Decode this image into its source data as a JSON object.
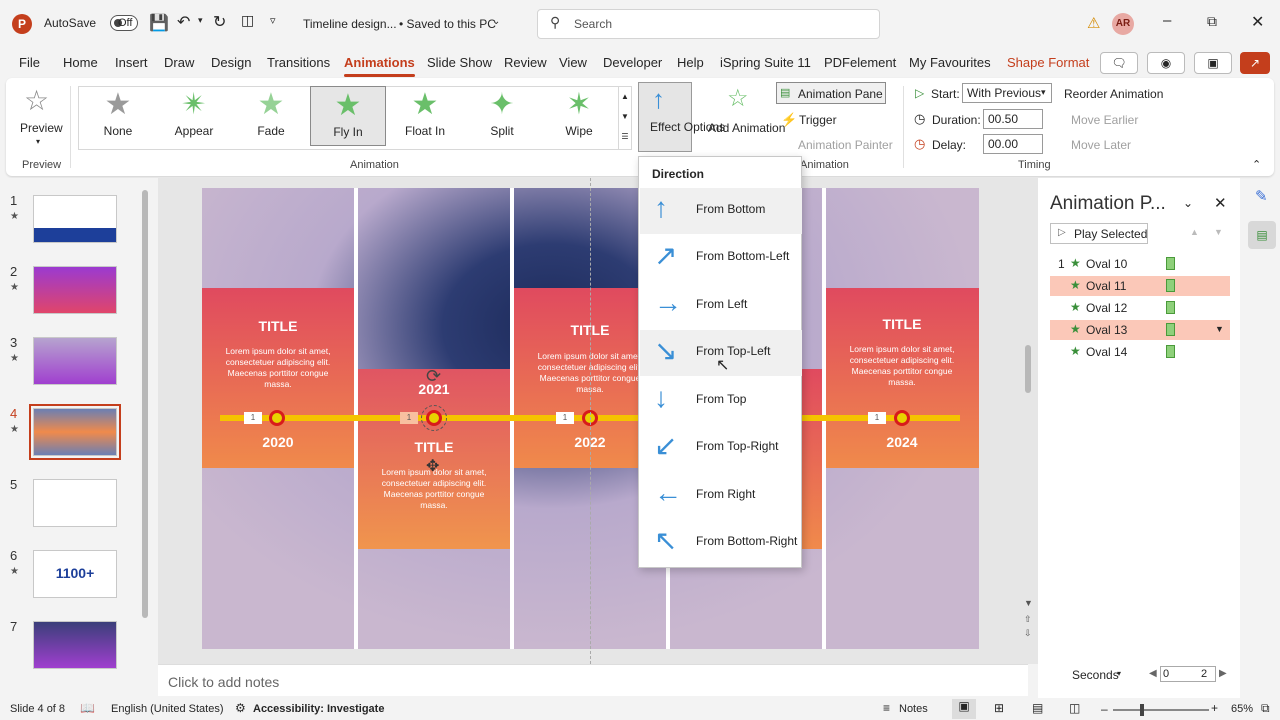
{
  "titlebar": {
    "logo": "P",
    "autosave_label": "AutoSave",
    "autosave_state": "Off",
    "doc_title": "Timeline design...",
    "save_status": "• Saved to this PC",
    "search_placeholder": "Search",
    "avatar_initials": "AR"
  },
  "menu": {
    "items": [
      "File",
      "Home",
      "Insert",
      "Draw",
      "Design",
      "Transitions",
      "Animations",
      "Slide Show",
      "Review",
      "View",
      "Developer",
      "Help",
      "iSpring Suite 11",
      "PDFelement",
      "My Favourites",
      "Shape Format"
    ],
    "active": "Animations"
  },
  "ribbon": {
    "preview_label": "Preview",
    "preview_group": "Preview",
    "animation_group": "Animation",
    "gallery": [
      "None",
      "Appear",
      "Fade",
      "Fly In",
      "Float In",
      "Split",
      "Wipe"
    ],
    "gallery_selected": "Fly In",
    "effect_options": "Effect Options",
    "add_animation": "Add Animation",
    "animation_pane_btn": "Animation Pane",
    "trigger": "Trigger",
    "animation_painter": "Animation Painter",
    "adv_group": "Animation",
    "start_label": "Start:",
    "start_value": "With Previous",
    "duration_label": "Duration:",
    "duration_value": "00.50",
    "delay_label": "Delay:",
    "delay_value": "00.00",
    "reorder": "Reorder Animation",
    "move_earlier": "Move Earlier",
    "move_later": "Move Later",
    "timing_group": "Timing"
  },
  "thumbs": {
    "numbers": [
      "1",
      "2",
      "3",
      "4",
      "5",
      "6",
      "7"
    ],
    "thumb6_text": "1100+"
  },
  "slide": {
    "panels": [
      {
        "title": "TITLE",
        "year": "2020",
        "tag": "1"
      },
      {
        "title": "TITLE",
        "year": "2021",
        "tag": "1"
      },
      {
        "title": "TITLE",
        "year": "2022",
        "tag": "1"
      },
      {
        "title": "TITLE",
        "year": "2024",
        "tag": "1"
      }
    ],
    "lorem": "Lorem ipsum dolor sit amet, consectetuer adipiscing elit. Maecenas porttitor congue massa."
  },
  "dropdown": {
    "header": "Direction",
    "items": [
      "From Bottom",
      "From Bottom-Left",
      "From Left",
      "From Top-Left",
      "From Top",
      "From Top-Right",
      "From Right",
      "From Bottom-Right"
    ]
  },
  "animation_pane": {
    "title": "Animation P...",
    "play_selected": "Play Selected",
    "rows": [
      {
        "num": "1",
        "name": "Oval 10"
      },
      {
        "num": "",
        "name": "Oval 11"
      },
      {
        "num": "",
        "name": "Oval 12"
      },
      {
        "num": "",
        "name": "Oval 13"
      },
      {
        "num": "",
        "name": "Oval 14"
      }
    ],
    "seconds": "Seconds",
    "timeline_start": "0",
    "timeline_end": "2"
  },
  "notes_placeholder": "Click to add notes",
  "status": {
    "slide_info": "Slide 4 of 8",
    "language": "English (United States)",
    "accessibility": "Accessibility: Investigate",
    "notes": "Notes",
    "zoom": "65%"
  },
  "colors": {
    "accent": "#c43e1c",
    "band_top": "#e04a5f",
    "band_bottom": "#f08a4b",
    "timeline": "#f5c400"
  }
}
